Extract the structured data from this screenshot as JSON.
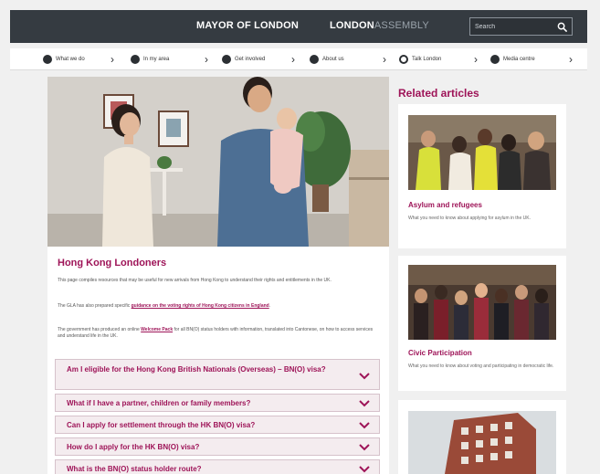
{
  "header": {
    "mayor_label": "MAYOR OF LONDON",
    "assembly_strong": "LONDON",
    "assembly_light": "ASSEMBLY",
    "search_placeholder": "Search"
  },
  "nav": {
    "items": [
      {
        "label": "What we do"
      },
      {
        "label": "In my area"
      },
      {
        "label": "Get involved"
      },
      {
        "label": "About us"
      },
      {
        "label": "Talk London"
      },
      {
        "label": "Media centre"
      }
    ]
  },
  "article": {
    "title": "Hong Kong Londoners",
    "para1": "This page compiles resources that may be useful for new arrivals from Hong Kong to understand their rights and entitlements in the UK.",
    "para2_prefix": "The GLA has also prepared specific ",
    "para2_link": "guidance on the voting rights of Hong Kong citizens in England",
    "para2_suffix": ".",
    "para3_prefix": "The government has produced an online ",
    "para3_link": "Welcome Pack",
    "para3_suffix": " for all BN(O) status holders with information, translated into Cantonese, on how to access services and understand life in the UK.",
    "accordion": [
      {
        "label": "Am I eligible for the Hong Kong British Nationals (Overseas) – BN(O) visa?"
      },
      {
        "label": "What if I have a partner, children or family members?"
      },
      {
        "label": "Can I apply for settlement through the HK BN(O) visa?"
      },
      {
        "label": "How do I apply for the HK BN(O) visa?"
      },
      {
        "label": "What is the BN(O) status holder route?"
      }
    ]
  },
  "related": {
    "title": "Related articles",
    "cards": [
      {
        "title": "Asylum and refugees",
        "desc": "What you need to know about applying for asylum in the UK."
      },
      {
        "title": "Civic Participation",
        "desc": "What you need to know about voting and participating in democratic life."
      }
    ]
  },
  "colors": {
    "header_bg": "#353b41",
    "accent": "#9e1458",
    "page_bg": "#f0f0f0"
  }
}
